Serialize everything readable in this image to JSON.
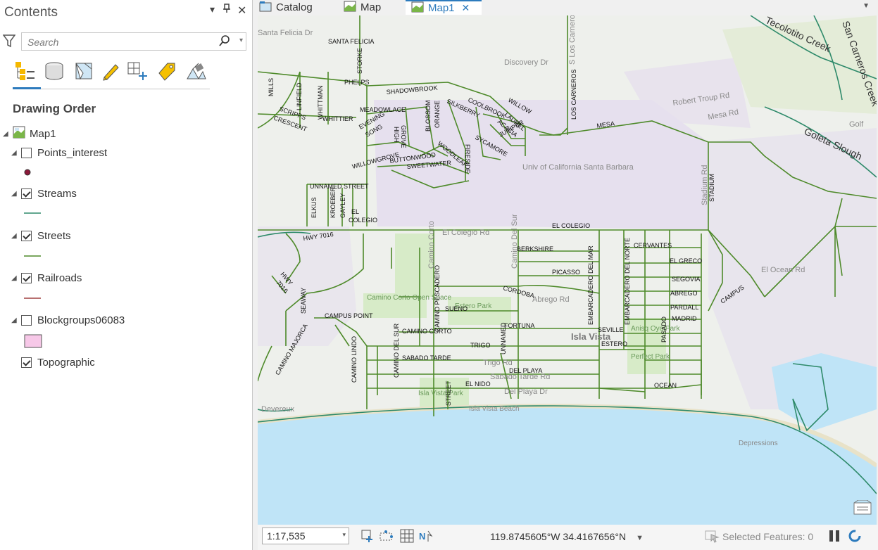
{
  "contents": {
    "title": "Contents",
    "search_placeholder": "Search",
    "heading": "Drawing Order",
    "map_name": "Map1",
    "layers": [
      {
        "name": "Points_interest",
        "checked": false
      },
      {
        "name": "Streams",
        "checked": true
      },
      {
        "name": "Streets",
        "checked": true
      },
      {
        "name": "Railroads",
        "checked": true
      },
      {
        "name": "Blockgroups06083",
        "checked": false
      },
      {
        "name": "Topographic",
        "checked": true
      }
    ]
  },
  "tabs": [
    {
      "label": "Catalog",
      "active": false
    },
    {
      "label": "Map",
      "active": false
    },
    {
      "label": "Map1",
      "active": true
    }
  ],
  "status": {
    "scale": "1:17,535",
    "coordinates": "119.8745605°W 34.4167656°N",
    "selected_features": "Selected Features: 0"
  },
  "map_labels": {
    "streets": [
      "SANTA FELICIA",
      "STORKE",
      "PHELPS",
      "MILLS",
      "LINFIELD",
      "SCRIPPS",
      "CRESCENT",
      "WHITTMAN",
      "WHITTIER",
      "SHADOWBROOK",
      "MEADOWLACE",
      "BLOSSOM",
      "ORANGE",
      "SILKBERRY",
      "COOLBROOK",
      "WILLOW",
      "LAUREL",
      "ACACIA",
      "JUNIPER",
      "EVENING",
      "SONG",
      "HIGH",
      "GROVE",
      "SYCAMORE",
      "FIRESIDE",
      "WOODLEAF",
      "BUTTONWOOD",
      "WILLOWGROVE",
      "SWEETWATER",
      "LOS CARNEROS",
      "MESA",
      "UNNAMED STREET",
      "ELKUS",
      "KROEBER",
      "GAYLEY",
      "EL",
      "COLEGIO",
      "EL COLEGIO",
      "STADIUM",
      "HWY 7016",
      "HWY",
      "7016",
      "BERKSHIRE",
      "CERVANTES",
      "PICASSO",
      "EL GRECO",
      "SEGOVIA",
      "ABREGO",
      "CORDOBA",
      "PARDALL",
      "MADRID",
      "SEVILLE",
      "ESTERO",
      "SUENO",
      "FORTUNA",
      "CAMINO CORTO",
      "CAMINO PESCADERO",
      "EMBARCADERO DEL MAR",
      "EMBARCADERO DEL NORTE",
      "PASADO",
      "TRIGO",
      "SABADO TARDE",
      "DEL PLAYA",
      "EL NIDO",
      "OCEAN",
      "CAMPUS",
      "CAMPUS POINT",
      "SEAWAY",
      "CAMINO MAJORCA",
      "CAMINO LINDO",
      "CAMINO DEL SUR",
      "UNNAMED",
      "STREET"
    ],
    "basemap": [
      "Santa Felicia Dr",
      "Discovery Dr",
      "Robert Troup Rd",
      "Mesa Rd",
      "El Colegio Rd",
      "El Ocean Rd",
      "Abrego Rd",
      "Isla Vista",
      "Trigo Rd",
      "Sabado Tarde Rd",
      "Del Playa Dr",
      "Isla Vista Park",
      "Isla Vista Beach",
      "Devereux",
      "Depressions",
      "Goleta Slough",
      "Tecolotito Creek",
      "San Carneros Creek",
      "Univ of California Santa Barbara",
      "Camino Corto Open Space",
      "Estero Park",
      "Anisq Oyo Park",
      "Perfect Park",
      "Stadium Rd",
      "S Los Carneros",
      "Golf",
      "Camino Corto",
      "Camino Del Sur",
      "El Colegio"
    ]
  },
  "colors": {
    "streets": "#4e8a2a",
    "streams": "#2e8a6a",
    "railroads": "#a04040",
    "points": "#8b1a3a",
    "blockgroups": "#f7c8e8",
    "ocean": "#bfe4f7",
    "land": "#eef0ec",
    "campus": "#e6e0ee",
    "park": "#d7ebc8",
    "accent": "#2d7bbd"
  }
}
